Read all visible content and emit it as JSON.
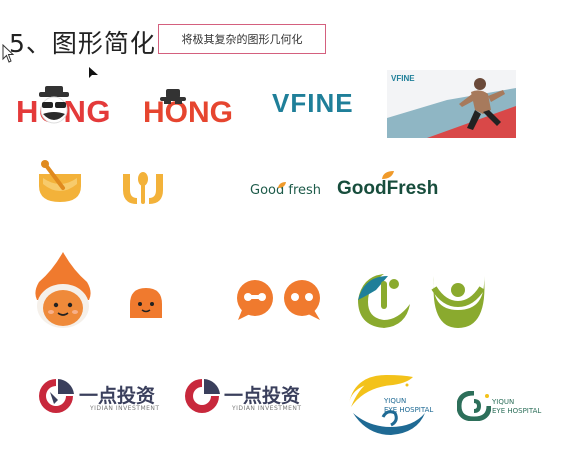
{
  "slide": {
    "title": "5、图形简化",
    "subtitle": "将极其复杂的图形几何化"
  },
  "logos": {
    "hong_detailed": {
      "wordmark": "HONG",
      "color": "#e43a3a"
    },
    "hong_simplified": {
      "wordmark": "HONG",
      "color": "#e6452f"
    },
    "vfine": {
      "wordmark": "VFINE",
      "photo_brand": "VFINE",
      "color": "#1f7f99"
    },
    "goodfresh_detailed": {
      "wordmark": "Good fresh"
    },
    "goodfresh_simplified": {
      "wordmark": "GoodFresh"
    },
    "yidian_detailed": {
      "name": "一点投资",
      "sub": "YIDIAN INVESTMENT"
    },
    "yidian_simplified": {
      "name": "一点投资",
      "sub": "YIDIAN INVESTMENT"
    },
    "yiqun_detailed": {
      "line1": "YIQUN",
      "line2": "EYE HOSPITAL"
    },
    "yiqun_simplified": {
      "line1": "YIQUN",
      "line2": "EYE HOSPITAL"
    }
  },
  "colors": {
    "orange": "#f07a2e",
    "honey": "#f3b23a",
    "olive": "#8aaa2e",
    "navy": "#3a3f5c",
    "crimson": "#c8283c",
    "teal": "#1f7f99"
  }
}
